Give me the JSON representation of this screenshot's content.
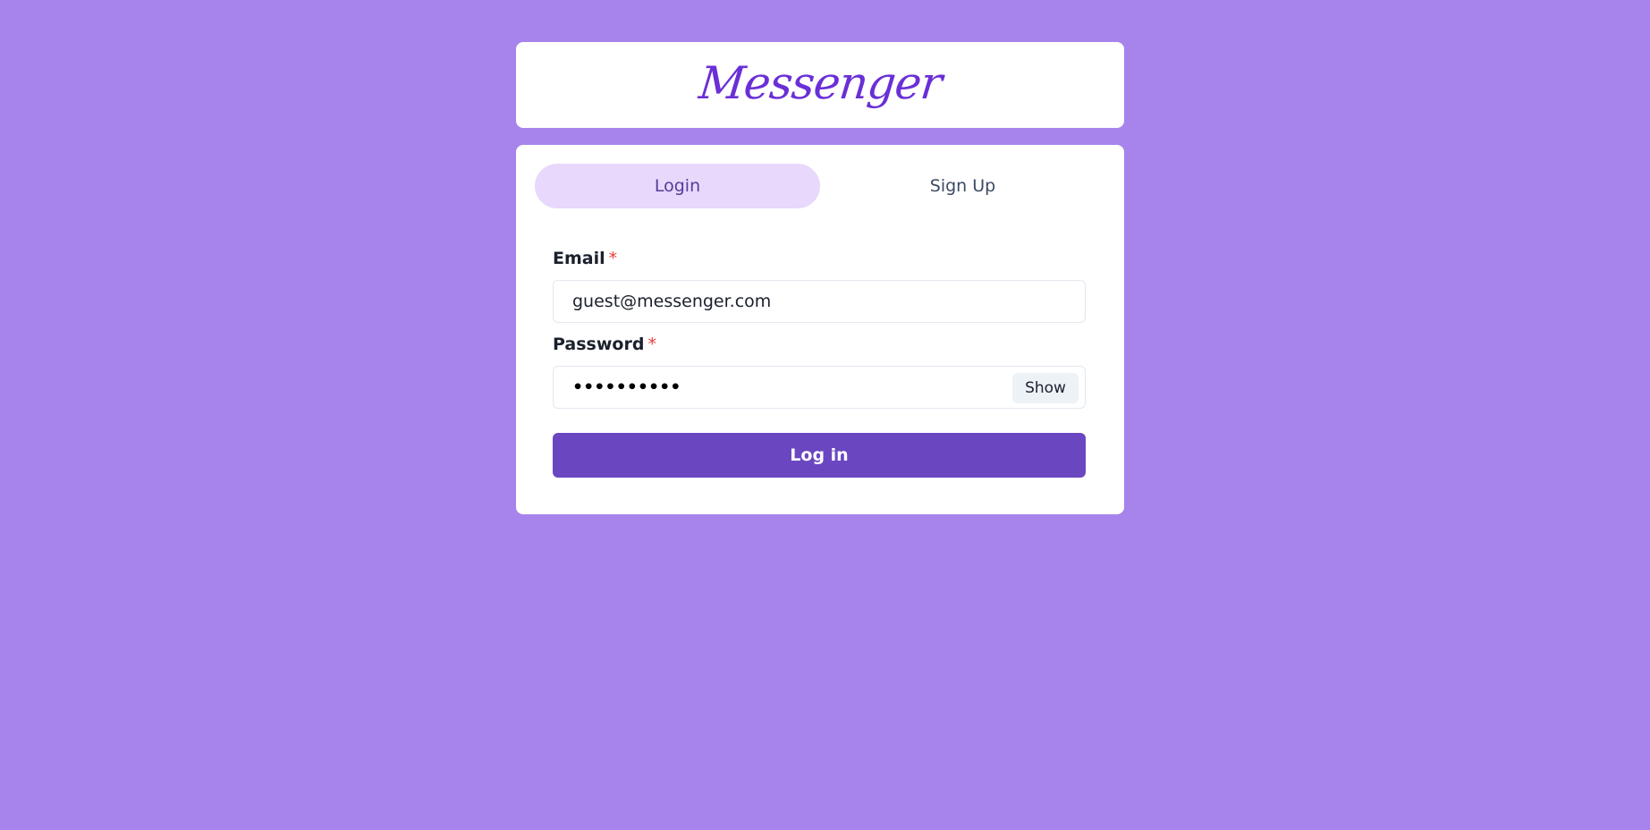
{
  "header": {
    "logo_text": "Messenger"
  },
  "tabs": [
    {
      "label": "Login",
      "active": true
    },
    {
      "label": "Sign Up",
      "active": false
    }
  ],
  "form": {
    "email": {
      "label": "Email",
      "required_mark": "*",
      "value": "guest@messenger.com"
    },
    "password": {
      "label": "Password",
      "required_mark": "*",
      "masked_value": "••••••••••",
      "show_label": "Show"
    },
    "submit_label": "Log in"
  },
  "colors": {
    "background": "#a784eb",
    "accent": "#6b46c1",
    "active_tab": "#e8d8fb",
    "logo": "#6a2fd6",
    "required": "#e53e3e"
  }
}
